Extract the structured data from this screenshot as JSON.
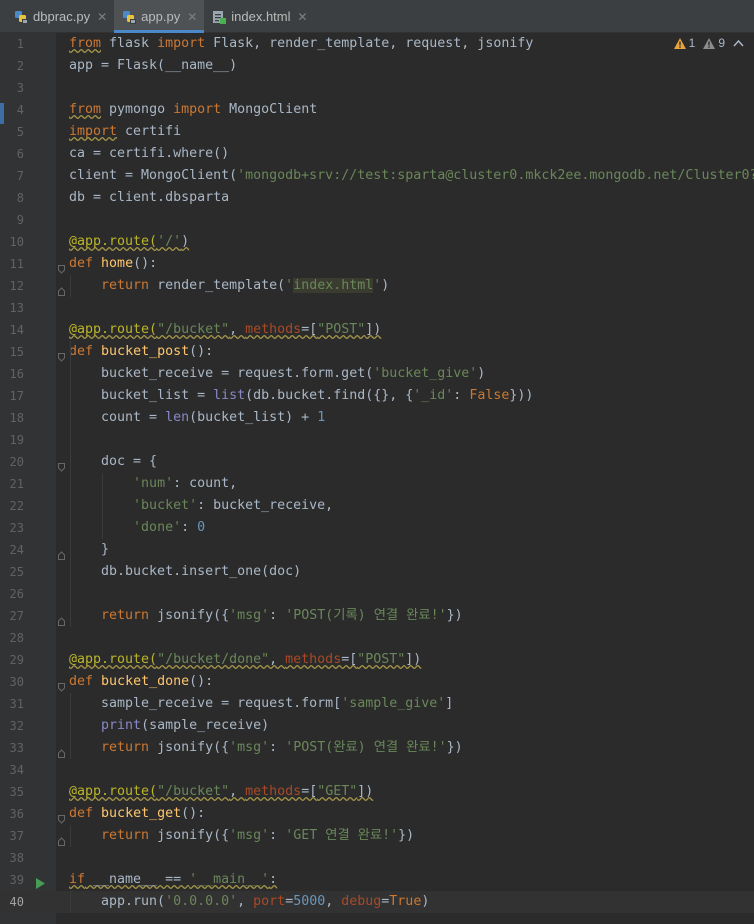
{
  "tabs": [
    {
      "label": "dbprac.py",
      "active": false,
      "icon": "python-file-icon"
    },
    {
      "label": "app.py",
      "active": true,
      "icon": "python-file-icon"
    },
    {
      "label": "index.html",
      "active": false,
      "icon": "html-file-icon"
    }
  ],
  "inspections": {
    "warnings": "1",
    "weak_warnings": "9"
  },
  "current_line": 40,
  "colors": {
    "keyword": "#cc7832",
    "string": "#6a8759",
    "number": "#6897bb",
    "decorator": "#bbb529",
    "function": "#ffc66d",
    "background": "#2b2b2b"
  },
  "lines": [
    [
      {
        "t": "from",
        "c": "kw sq"
      },
      {
        "t": " flask "
      },
      {
        "t": "import",
        "c": "kw"
      },
      {
        "t": " Flask, render_template, request, jsonify"
      }
    ],
    [
      {
        "t": "app = Flask(__name__)"
      }
    ],
    [],
    [
      {
        "t": "from",
        "c": "kw sq"
      },
      {
        "t": " pymongo "
      },
      {
        "t": "import",
        "c": "kw"
      },
      {
        "t": " MongoClient"
      }
    ],
    [
      {
        "t": "import",
        "c": "kw sq"
      },
      {
        "t": " certifi"
      }
    ],
    [
      {
        "t": "ca = certifi.where()"
      }
    ],
    [
      {
        "t": "client = MongoClient("
      },
      {
        "t": "'mongodb+srv://test:sparta@cluster0.mkck2ee.mongodb.net/Cluster0?",
        "c": "str"
      }
    ],
    [
      {
        "t": "db = client.dbsparta"
      }
    ],
    [],
    [
      {
        "t": "@app.route(",
        "c": "dec sq"
      },
      {
        "t": "'/'",
        "c": "str sq"
      },
      {
        "t": ")",
        "c": "sq"
      }
    ],
    [
      {
        "t": "def",
        "c": "kw"
      },
      {
        "t": " "
      },
      {
        "t": "home",
        "c": "fn"
      },
      {
        "t": "():"
      }
    ],
    [
      {
        "t": "    "
      },
      {
        "t": "return",
        "c": "kw"
      },
      {
        "t": " render_template("
      },
      {
        "t": "'",
        "c": "str"
      },
      {
        "t": "index.html",
        "c": "str hl"
      },
      {
        "t": "'",
        "c": "str"
      },
      {
        "t": ")"
      }
    ],
    [],
    [
      {
        "t": "@app.route(",
        "c": "dec sq"
      },
      {
        "t": "\"/bucket\"",
        "c": "str sq"
      },
      {
        "t": ", ",
        "c": "sq"
      },
      {
        "t": "methods",
        "c": "par sq"
      },
      {
        "t": "=[",
        "c": "sq"
      },
      {
        "t": "\"POST\"",
        "c": "str sq"
      },
      {
        "t": "])",
        "c": "sq"
      }
    ],
    [
      {
        "t": "def",
        "c": "kw"
      },
      {
        "t": " "
      },
      {
        "t": "bucket_post",
        "c": "fn"
      },
      {
        "t": "():"
      }
    ],
    [
      {
        "t": "    bucket_receive = request.form.get("
      },
      {
        "t": "'bucket_give'",
        "c": "str"
      },
      {
        "t": ")"
      }
    ],
    [
      {
        "t": "    bucket_list = "
      },
      {
        "t": "list",
        "c": "bi"
      },
      {
        "t": "(db.bucket.find({}, {"
      },
      {
        "t": "'_id'",
        "c": "str"
      },
      {
        "t": ": "
      },
      {
        "t": "False",
        "c": "kw"
      },
      {
        "t": "}))"
      }
    ],
    [
      {
        "t": "    count = "
      },
      {
        "t": "len",
        "c": "bi"
      },
      {
        "t": "(bucket_list) + "
      },
      {
        "t": "1",
        "c": "num"
      }
    ],
    [],
    [
      {
        "t": "    doc = {"
      }
    ],
    [
      {
        "t": "        "
      },
      {
        "t": "'num'",
        "c": "str"
      },
      {
        "t": ": count,"
      }
    ],
    [
      {
        "t": "        "
      },
      {
        "t": "'bucket'",
        "c": "str"
      },
      {
        "t": ": bucket_receive,"
      }
    ],
    [
      {
        "t": "        "
      },
      {
        "t": "'done'",
        "c": "str"
      },
      {
        "t": ": "
      },
      {
        "t": "0",
        "c": "num"
      }
    ],
    [
      {
        "t": "    }"
      }
    ],
    [
      {
        "t": "    db.bucket.insert_one(doc)"
      }
    ],
    [],
    [
      {
        "t": "    "
      },
      {
        "t": "return",
        "c": "kw"
      },
      {
        "t": " jsonify({"
      },
      {
        "t": "'msg'",
        "c": "str"
      },
      {
        "t": ": "
      },
      {
        "t": "'POST(기록) 연결 완료!'",
        "c": "str"
      },
      {
        "t": "})"
      }
    ],
    [],
    [
      {
        "t": "@app.route(",
        "c": "dec sq"
      },
      {
        "t": "\"/bucket/done\"",
        "c": "str sq"
      },
      {
        "t": ", ",
        "c": "sq"
      },
      {
        "t": "methods",
        "c": "par sq"
      },
      {
        "t": "=[",
        "c": "sq"
      },
      {
        "t": "\"POST\"",
        "c": "str sq"
      },
      {
        "t": "])",
        "c": "sq"
      }
    ],
    [
      {
        "t": "def",
        "c": "kw"
      },
      {
        "t": " "
      },
      {
        "t": "bucket_done",
        "c": "fn"
      },
      {
        "t": "():"
      }
    ],
    [
      {
        "t": "    sample_receive = request.form["
      },
      {
        "t": "'sample_give'",
        "c": "str"
      },
      {
        "t": "]"
      }
    ],
    [
      {
        "t": "    "
      },
      {
        "t": "print",
        "c": "bi"
      },
      {
        "t": "(sample_receive)"
      }
    ],
    [
      {
        "t": "    "
      },
      {
        "t": "return",
        "c": "kw"
      },
      {
        "t": " jsonify({"
      },
      {
        "t": "'msg'",
        "c": "str"
      },
      {
        "t": ": "
      },
      {
        "t": "'POST(완료) 연결 완료!'",
        "c": "str"
      },
      {
        "t": "})"
      }
    ],
    [],
    [
      {
        "t": "@app.route(",
        "c": "dec sq"
      },
      {
        "t": "\"/bucket\"",
        "c": "str sq"
      },
      {
        "t": ", ",
        "c": "sq"
      },
      {
        "t": "methods",
        "c": "par sq"
      },
      {
        "t": "=[",
        "c": "sq"
      },
      {
        "t": "\"GET\"",
        "c": "str sq"
      },
      {
        "t": "])",
        "c": "sq"
      }
    ],
    [
      {
        "t": "def",
        "c": "kw"
      },
      {
        "t": " "
      },
      {
        "t": "bucket_get",
        "c": "fn"
      },
      {
        "t": "():"
      }
    ],
    [
      {
        "t": "    "
      },
      {
        "t": "return",
        "c": "kw"
      },
      {
        "t": " jsonify({"
      },
      {
        "t": "'msg'",
        "c": "str"
      },
      {
        "t": ": "
      },
      {
        "t": "'GET 연결 완료!'",
        "c": "str"
      },
      {
        "t": "})"
      }
    ],
    [],
    [
      {
        "t": "if",
        "c": "kw sq"
      },
      {
        "t": " __name__ == ",
        "c": "sq"
      },
      {
        "t": "'__main__'",
        "c": "str sq"
      },
      {
        "t": ":",
        "c": "sq"
      }
    ],
    [
      {
        "t": "    app.run("
      },
      {
        "t": "'0.0.0.0'",
        "c": "str"
      },
      {
        "t": ", "
      },
      {
        "t": "port",
        "c": "par"
      },
      {
        "t": "="
      },
      {
        "t": "5000",
        "c": "num"
      },
      {
        "t": ", "
      },
      {
        "t": "debug",
        "c": "par"
      },
      {
        "t": "="
      },
      {
        "t": "True",
        "c": "kw"
      },
      {
        "t": ")"
      }
    ]
  ]
}
